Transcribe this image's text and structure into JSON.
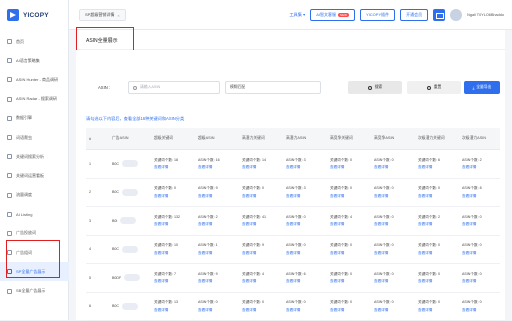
{
  "app": {
    "logo_text": "YICOPY",
    "tab_title": "SP超级营销详情",
    "tab_close": "×"
  },
  "sidebar": {
    "items": [
      {
        "label": "首页"
      },
      {
        "label": "AI语言策略集"
      },
      {
        "label": "ASIN Hunter - 商品调研"
      },
      {
        "label": "ASIN Radar - 搜索调研"
      },
      {
        "label": "数据引擎"
      },
      {
        "label": "词语爬虫"
      },
      {
        "label": "关键词搜索分析"
      },
      {
        "label": "关键词运营看板"
      },
      {
        "label": "流量调度"
      },
      {
        "label": "AI Listing"
      },
      {
        "label": "广告投放词"
      },
      {
        "label": "广告组词"
      },
      {
        "label": "SP全量广告展示"
      },
      {
        "label": "SB全量广告展示"
      }
    ]
  },
  "topbar": {
    "tools_label": "工具集",
    "tools_chevron": "▾",
    "ai_button_label": "AI智文客服",
    "ai_badge": "NEW",
    "yicopy_plugin_label": "YICOPY插件",
    "open_member_label": "开通会员",
    "user_name": "Ngali T0YLO6Bhaddo"
  },
  "page": {
    "title": "ASIN全量展示"
  },
  "search": {
    "asin_label": "ASIN :",
    "asin_placeholder": "请输入ASIN",
    "match_value": "模糊匹配",
    "search_button": "搜索",
    "reset_button": "重置",
    "export_button": "全量导出"
  },
  "notice": "请勾选以下内容后，查看全部16种关键词和ASIN分类",
  "table": {
    "headers": [
      "#",
      "广告ASIN",
      "超级关键词",
      "超级ASIN",
      "高潜力关键词",
      "高潜力ASIN",
      "高竞争关键词",
      "高竞争ASIN",
      "次级潜力关键词",
      "次级潜力ASIN"
    ],
    "rows": [
      {
        "no": "1",
        "ad_asin": "B0C",
        "cells": [
          "关键词个数: 18",
          "ASIN个数: 16",
          "关键词个数: 14",
          "ASIN个数: 3",
          "关键词个数: 0",
          "ASIN个数: 0",
          "关键词个数: 6",
          "ASIN个数: 2"
        ]
      },
      {
        "no": "2",
        "ad_asin": "B0C",
        "cells": [
          "关键词个数: 0",
          "ASIN个数: 9",
          "关键词个数: 0",
          "ASIN个数: 3",
          "关键词个数: 0",
          "ASIN个数: 0",
          "关键词个数: 0",
          "ASIN个数: 8"
        ]
      },
      {
        "no": "3",
        "ad_asin": "B0I",
        "cells": [
          "关键词个数: 132",
          "ASIN个数: 2",
          "关键词个数: 41",
          "ASIN个数: 0",
          "关键词个数: 4",
          "ASIN个数: 0",
          "关键词个数: 2",
          "ASIN个数: 0"
        ]
      },
      {
        "no": "4",
        "ad_asin": "B0C",
        "cells": [
          "关键词个数: 10",
          "ASIN个数: 1",
          "关键词个数: 9",
          "ASIN个数: 0",
          "关键词个数: 0",
          "ASIN个数: 0",
          "关键词个数: 0",
          "ASIN个数: 0"
        ]
      },
      {
        "no": "5",
        "ad_asin": "B0DF",
        "cells": [
          "关键词个数: 7",
          "ASIN个数: 9",
          "关键词个数: 4",
          "ASIN个数: 6",
          "关键词个数: 0",
          "ASIN个数: 0",
          "关键词个数: 0",
          "ASIN个数: 0"
        ]
      },
      {
        "no": "6",
        "ad_asin": "B0C",
        "cells": [
          "关键词个数: 13",
          "ASIN个数: 0",
          "关键词个数: 0",
          "ASIN个数: 0",
          "关键词个数: 0",
          "ASIN个数: 0",
          "关键词个数: 0",
          "ASIN个数: 0"
        ]
      }
    ],
    "link_text": "查看详情"
  },
  "colors": {
    "accent": "#2f6fed",
    "annotation_red": "#e02020"
  }
}
